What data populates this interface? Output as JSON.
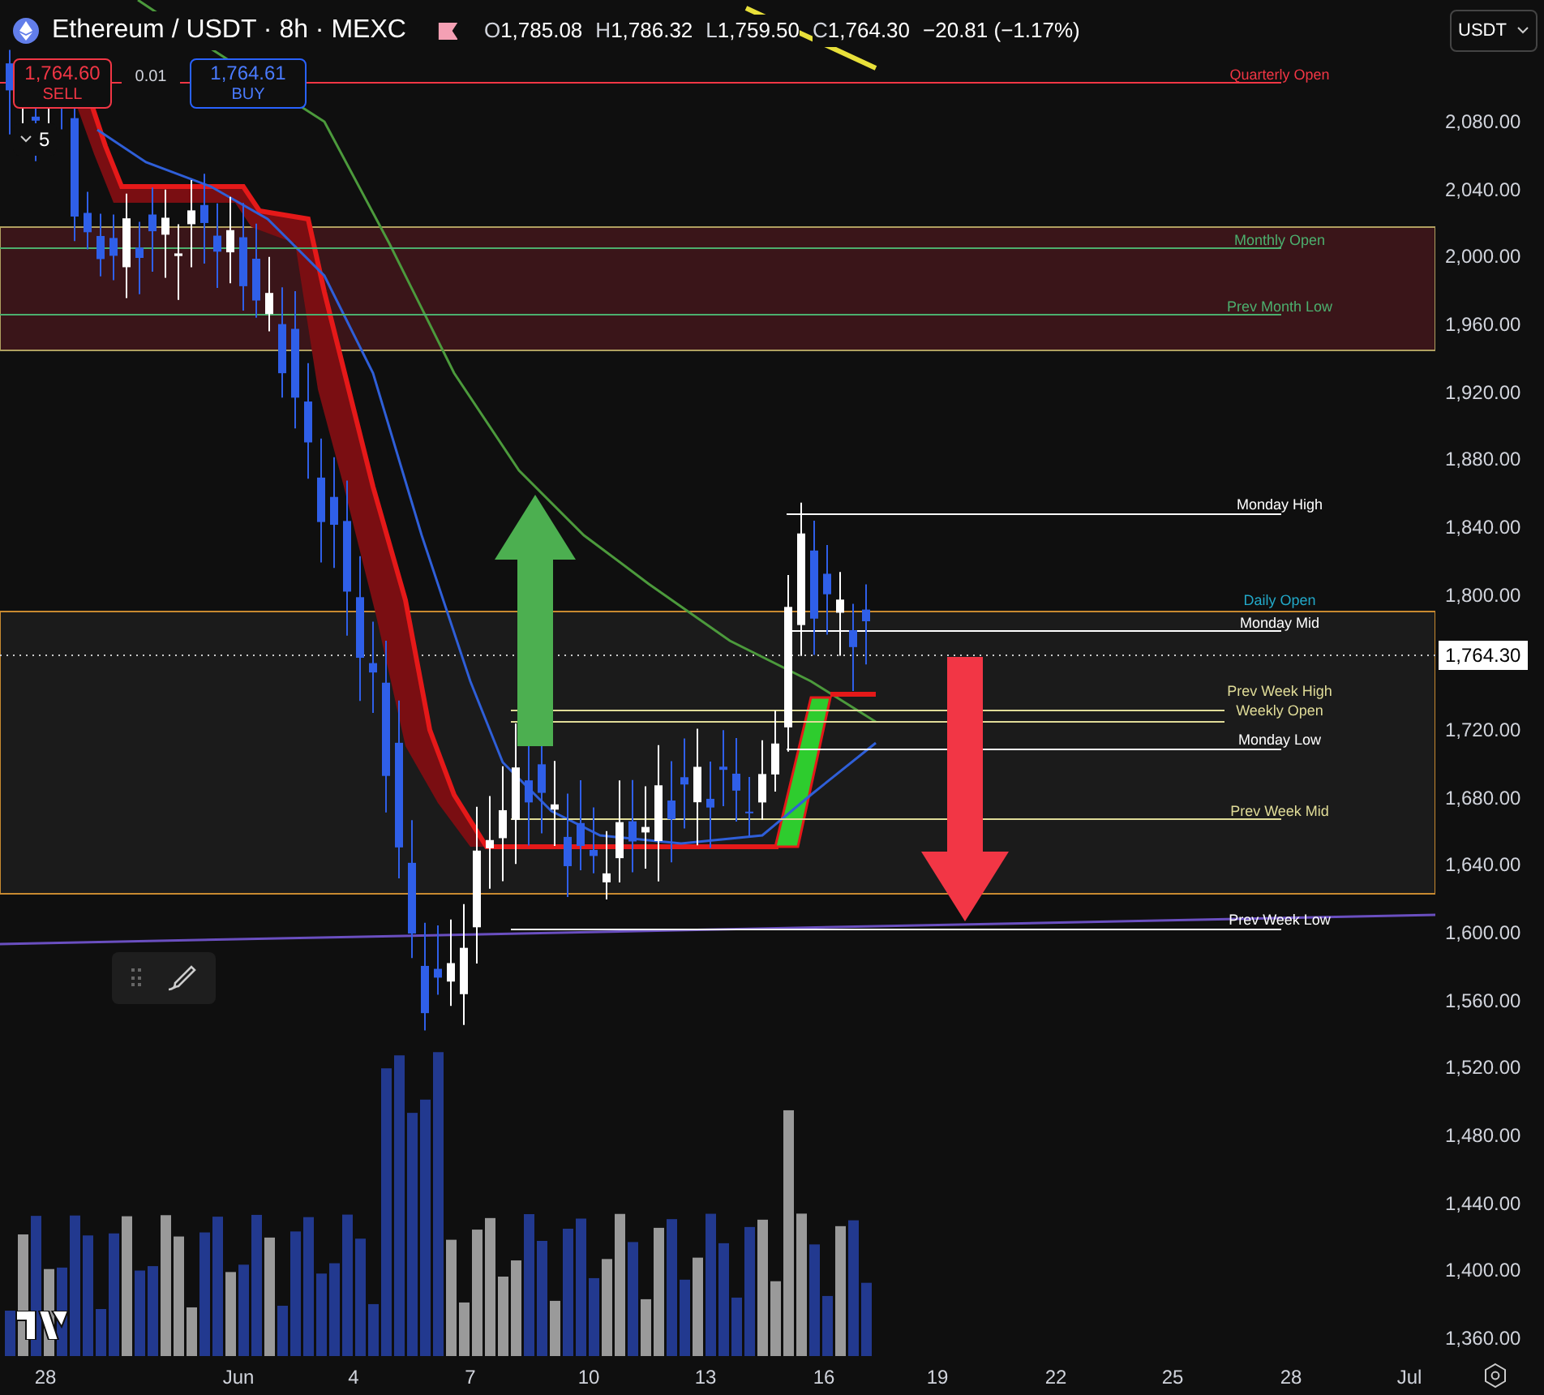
{
  "header": {
    "symbol": "Ethereum / USDT · 8h · MEXC",
    "ohlc": [
      {
        "label": "O",
        "value": "1,785.08"
      },
      {
        "label": "H",
        "value": "1,786.32"
      },
      {
        "label": "L",
        "value": "1,759.50"
      },
      {
        "label": "C",
        "value": "1,764.30"
      }
    ],
    "change": "−20.81 (−1.17%)",
    "currency": "USDT"
  },
  "trade": {
    "sell_price": "1,764.60",
    "sell_label": "SELL",
    "spread": "0.01",
    "buy_price": "1,764.61",
    "buy_label": "BUY"
  },
  "indicators_toggle": {
    "count": "5"
  },
  "levels": [
    {
      "label": "Quarterly Open",
      "color": "#f23645"
    },
    {
      "label": "Monthly Open",
      "color": "#4caf6e"
    },
    {
      "label": "Prev Month Low",
      "color": "#4caf6e"
    },
    {
      "label": "Monday High",
      "color": "#ffffff"
    },
    {
      "label": "Daily Open",
      "color": "#22a8c8"
    },
    {
      "label": "Monday Mid",
      "color": "#ffffff"
    },
    {
      "label": "Prev Week High",
      "color": "#e0dc98"
    },
    {
      "label": "Weekly Open",
      "color": "#e0dc98"
    },
    {
      "label": "Monday Low",
      "color": "#ffffff"
    },
    {
      "label": "Prev Week Mid",
      "color": "#e0dc98"
    },
    {
      "label": "Prev Week Low",
      "color": "#ffffff"
    }
  ],
  "price_axis": {
    "ticks": [
      "2,080.00",
      "2,040.00",
      "2,000.00",
      "1,960.00",
      "1,920.00",
      "1,880.00",
      "1,840.00",
      "1,800.00",
      "1,720.00",
      "1,680.00",
      "1,640.00",
      "1,600.00",
      "1,560.00",
      "1,520.00",
      "1,480.00",
      "1,440.00",
      "1,400.00",
      "1,360.00"
    ],
    "current_price": "1,764.30"
  },
  "time_axis": {
    "labels": [
      "28",
      "Jun",
      "4",
      "7",
      "10",
      "13",
      "16",
      "19",
      "22",
      "25",
      "28",
      "Jul"
    ]
  }
}
